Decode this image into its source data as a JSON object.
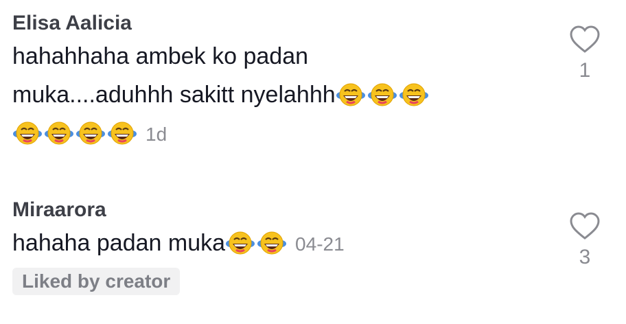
{
  "comments": [
    {
      "author": "Elisa Aalicia",
      "text_line1": "hahahhaha ambek ko padan",
      "text_line2": "muka....aduhhh sakitt nyelahhh",
      "emoji_group_a": "face-with-tears-of-joy-icon x3",
      "emoji_group_b": "face-with-tears-of-joy-icon x4",
      "time": "1d",
      "likes": "1"
    },
    {
      "author": "Miraarora",
      "text_line1": "hahaha padan muka",
      "emoji_group_a": "face-with-tears-of-joy-icon x2",
      "time": "04-21",
      "likes": "3",
      "badge": "Liked by creator"
    }
  ],
  "colors": {
    "text": "#161823",
    "muted": "#8a8b91",
    "badge_bg": "#f1f1f2"
  }
}
